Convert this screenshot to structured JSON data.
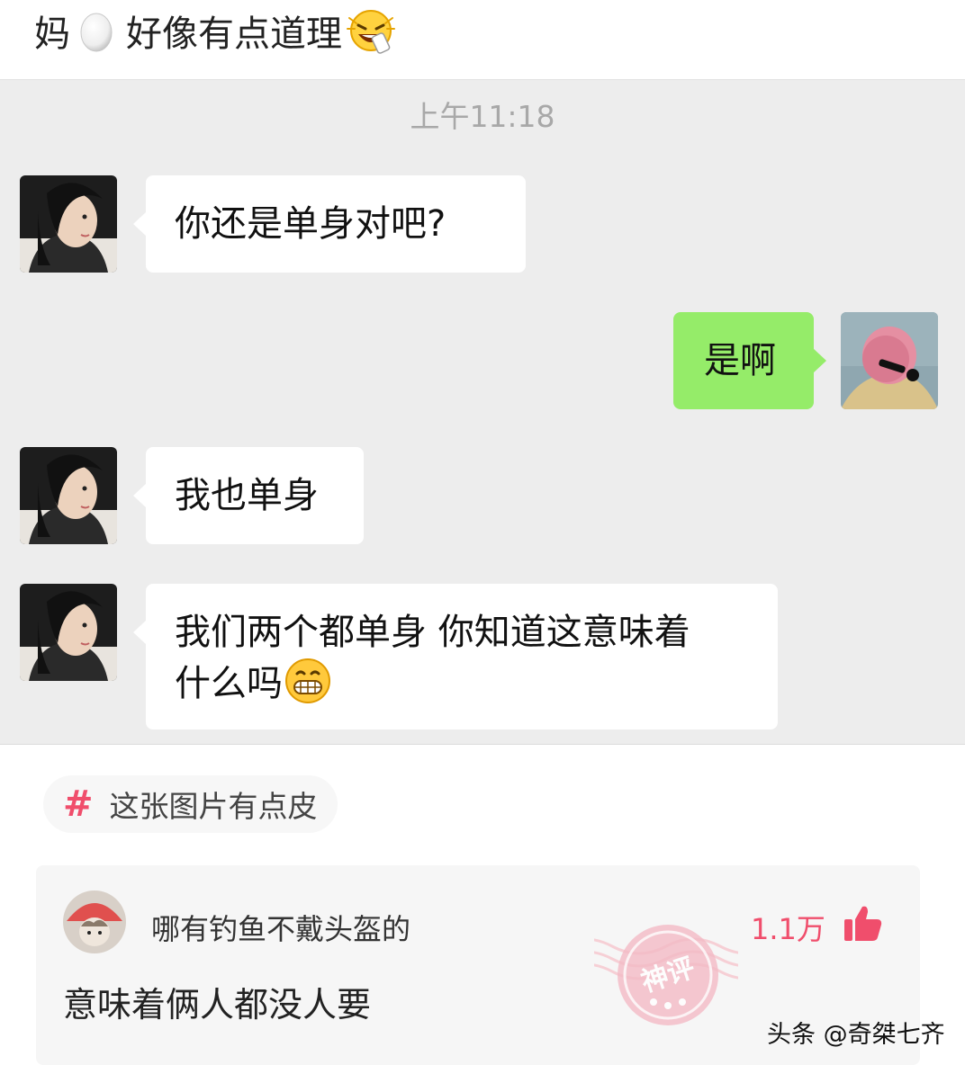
{
  "post": {
    "title_prefix": "妈",
    "title_text": "好像有点道理"
  },
  "chat": {
    "timestamp": "上午11:18",
    "messages": [
      {
        "side": "in",
        "text": "你还是单身对吧?"
      },
      {
        "side": "out",
        "text": "是啊"
      },
      {
        "side": "in",
        "text": "我也单身"
      },
      {
        "side": "in",
        "line1": "我们两个都单身 你知道这意味着",
        "line2": "什么吗"
      }
    ]
  },
  "topic": {
    "hash": "#",
    "label": "这张图片有点皮"
  },
  "comment": {
    "author": "哪有钓鱼不戴头盔的",
    "likes": "1.1万",
    "text": "意味着俩人都没人要",
    "stamp_text": "神评"
  },
  "watermark": "头条 @奇桀七齐",
  "icons": {
    "title_icons": [
      "egg-icon",
      "laughing-face-icon"
    ],
    "emoji_in_message": "grinning-face-icon",
    "like": "thumbs-up-icon"
  },
  "colors": {
    "chat_bg": "#ededed",
    "bubble_in": "#ffffff",
    "bubble_out": "#95ec69",
    "accent": "#f04e6c"
  }
}
